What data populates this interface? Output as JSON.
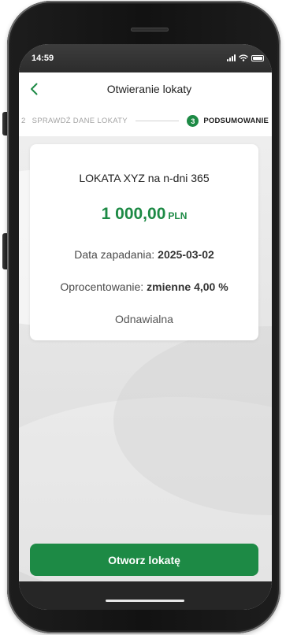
{
  "status_bar": {
    "time": "14:59",
    "icons": [
      "signal-icon",
      "wifi-icon",
      "battery-icon"
    ]
  },
  "header": {
    "title": "Otwieranie lokaty",
    "back_icon": "chevron-left-icon"
  },
  "stepper": {
    "previous": {
      "number": "2",
      "label": "SPRAWDŹ DANE LOKATY"
    },
    "current": {
      "number": "3",
      "label": "PODSUMOWANIE"
    }
  },
  "summary_card": {
    "product_name": "LOKATA XYZ na n-dni 365",
    "amount": "1 000,00",
    "currency": "PLN",
    "maturity_label": "Data zapadania:",
    "maturity_date": "2025-03-02",
    "interest_label": "Oprocentowanie:",
    "interest_value": "zmienne 4,00 %",
    "renewal": "Odnawialna"
  },
  "actions": {
    "open_deposit_label": "Otworz lokatę"
  },
  "colors": {
    "accent": "#1d8a45",
    "phone_body": "#121212",
    "screen_background": "#e4e4e4"
  }
}
